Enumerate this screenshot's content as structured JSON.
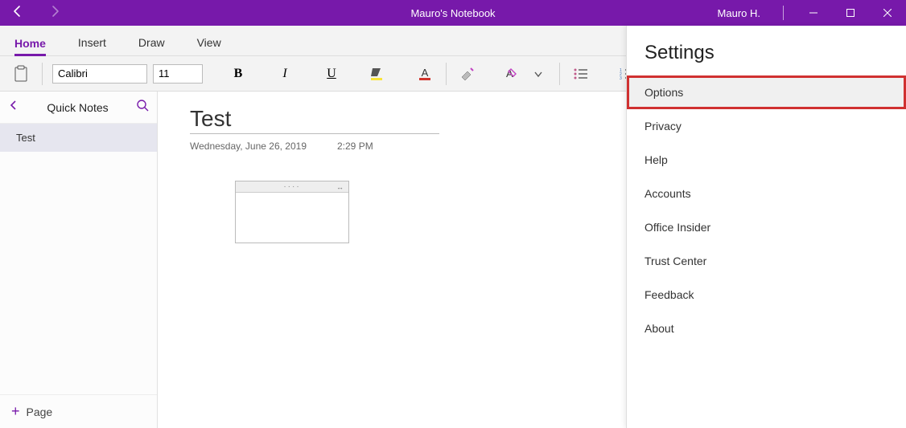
{
  "window": {
    "title": "Mauro's Notebook",
    "user": "Mauro H."
  },
  "menu_tabs": {
    "home": "Home",
    "insert": "Insert",
    "draw": "Draw",
    "view": "View"
  },
  "ribbon": {
    "font_name": "Calibri",
    "font_size": "11"
  },
  "sidebar": {
    "section_title": "Quick Notes",
    "pages": [
      "Test"
    ],
    "add_page_label": "Page"
  },
  "note": {
    "title": "Test",
    "date": "Wednesday, June 26, 2019",
    "time": "2:29 PM"
  },
  "settings": {
    "title": "Settings",
    "items": {
      "options": "Options",
      "privacy": "Privacy",
      "help": "Help",
      "accounts": "Accounts",
      "office_insider": "Office Insider",
      "trust_center": "Trust Center",
      "feedback": "Feedback",
      "about": "About"
    }
  }
}
